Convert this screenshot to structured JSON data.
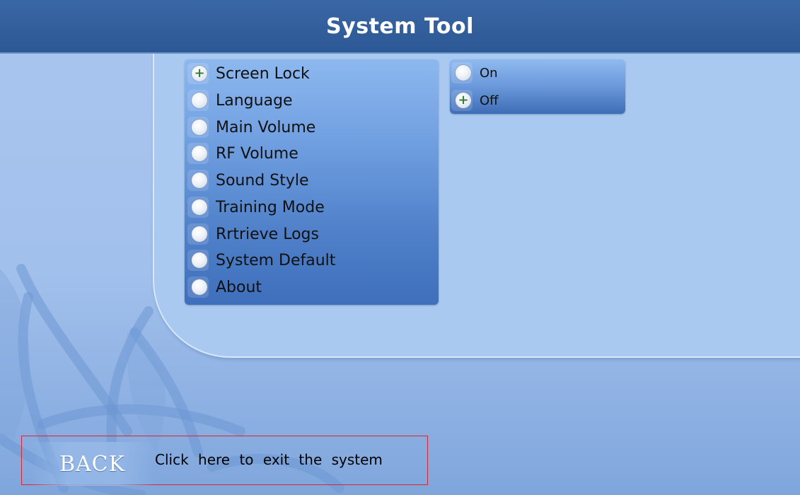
{
  "header": {
    "title": "System Tool"
  },
  "menu": {
    "items": [
      {
        "label": "Screen Lock",
        "selected": true
      },
      {
        "label": "Language",
        "selected": false
      },
      {
        "label": "Main Volume",
        "selected": false
      },
      {
        "label": "RF Volume",
        "selected": false
      },
      {
        "label": "Sound Style",
        "selected": false
      },
      {
        "label": "Training Mode",
        "selected": false
      },
      {
        "label": "Rrtrieve Logs",
        "selected": false
      },
      {
        "label": "System Default",
        "selected": false
      },
      {
        "label": "About",
        "selected": false
      }
    ]
  },
  "options": {
    "items": [
      {
        "label": "On",
        "selected": false
      },
      {
        "label": "Off",
        "selected": true
      }
    ]
  },
  "footer": {
    "back_label": "BACK",
    "back_hint": "Click here to exit the system"
  },
  "icons": {
    "selected": "plus-icon",
    "unselected": "radio-empty-icon"
  },
  "colors": {
    "title_bar": "#2c5895",
    "background": "#a9c6ef",
    "highlight_border": "#e2212a",
    "selected_mark": "#3a7a3a"
  }
}
